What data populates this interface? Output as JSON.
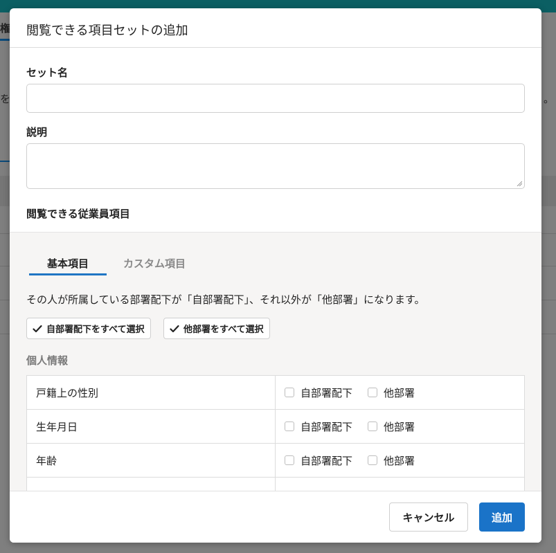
{
  "background": {
    "tab_fragment": "権",
    "left_fragment": "を",
    "right_fragment": "。"
  },
  "modal": {
    "title": "閲覧できる項目セットの追加",
    "set_name": {
      "label": "セット名",
      "value": "",
      "placeholder": ""
    },
    "description": {
      "label": "説明",
      "value": "",
      "placeholder": ""
    },
    "employee_items_label": "閲覧できる従業員項目",
    "tabs": [
      {
        "label": "基本項目",
        "active": true
      },
      {
        "label": "カスタム項目",
        "active": false
      }
    ],
    "explanation": "その人が所属している部署配下が「自部署配下」、それ以外が「他部署」になります。",
    "select_all_own": "自部署配下をすべて選択",
    "select_all_other": "他部署をすべて選択",
    "section_heading": "個人情報",
    "option_own": "自部署配下",
    "option_other": "他部署",
    "rows": [
      {
        "name": "戸籍上の性別",
        "own_checked": false,
        "other_checked": false
      },
      {
        "name": "生年月日",
        "own_checked": false,
        "other_checked": false
      },
      {
        "name": "年齢",
        "own_checked": false,
        "other_checked": false
      },
      {
        "name": "",
        "own_checked": false,
        "other_checked": false
      }
    ],
    "cancel_label": "キャンセル",
    "add_label": "追加"
  },
  "colors": {
    "primary": "#1a73c8",
    "tab_underline": "#1f75c4",
    "topbar": "#0b5f63"
  }
}
